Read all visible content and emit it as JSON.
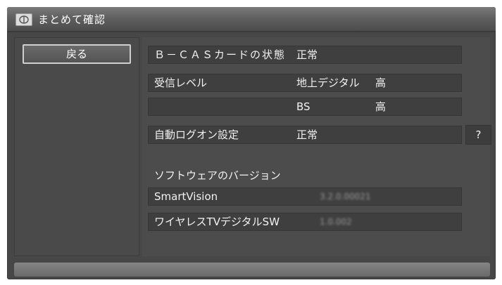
{
  "title": "まとめて確認",
  "icons": {
    "title": "disc-icon"
  },
  "sidebar": {
    "back_label": "戻る"
  },
  "rows": {
    "bcas": {
      "label": "Ｂ－ＣＡＳカードの状態",
      "value": "正常"
    },
    "signal": {
      "label": "受信レベル",
      "type": "地上デジタル",
      "level": "高"
    },
    "signal_bs": {
      "type": "BS",
      "level": "高"
    },
    "autologon": {
      "label": "自動ログオン設定",
      "value": "正常"
    }
  },
  "help_label": "?",
  "versions": {
    "heading": "ソフトウェアのバージョン",
    "items": [
      {
        "name": "SmartVision",
        "version": "3.2.0.00021"
      },
      {
        "name": "ワイヤレスTVデジタルSW",
        "version": "1.0.002"
      }
    ]
  }
}
